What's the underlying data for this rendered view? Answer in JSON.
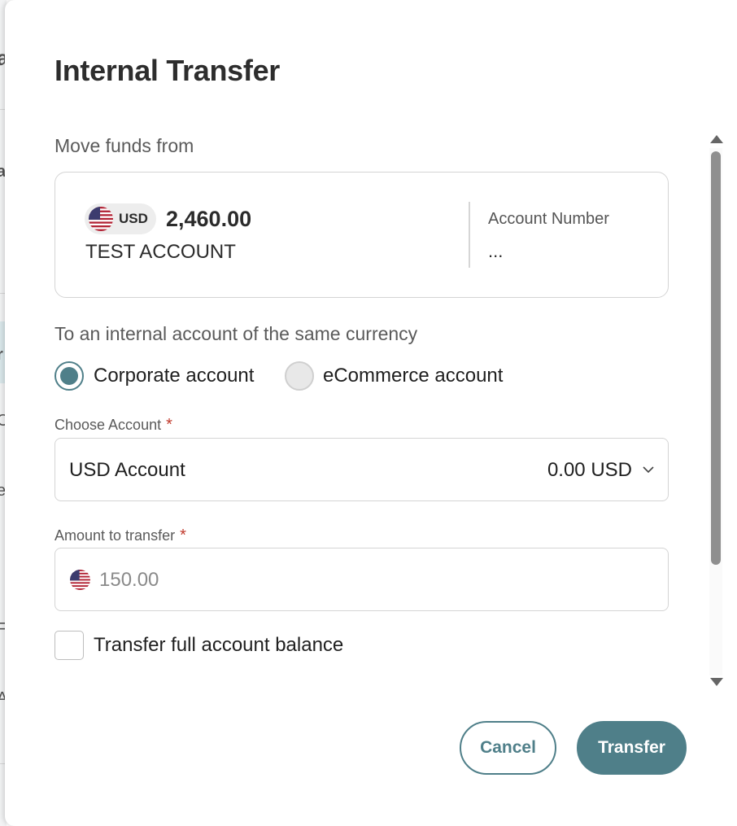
{
  "modal": {
    "title": "Internal Transfer"
  },
  "from": {
    "section_label": "Move funds from",
    "currency_code": "USD",
    "balance": "2,460.00",
    "account_name": "TEST ACCOUNT",
    "account_number_label": "Account Number",
    "account_number_value": "..."
  },
  "to": {
    "section_label": "To an internal account of the same currency",
    "options": [
      {
        "label": "Corporate account",
        "selected": true
      },
      {
        "label": "eCommerce account",
        "selected": false
      }
    ]
  },
  "choose_account": {
    "label": "Choose Account",
    "required_mark": "*",
    "selected_value": "USD Account",
    "selected_balance": "0.00 USD"
  },
  "amount": {
    "label": "Amount to transfer",
    "required_mark": "*",
    "placeholder": "150.00",
    "value": ""
  },
  "full_balance": {
    "label": "Transfer full account balance",
    "checked": false
  },
  "actions": {
    "cancel_label": "Cancel",
    "transfer_label": "Transfer"
  },
  "background": {
    "fragments": [
      "a",
      "a",
      "r",
      "C",
      "e",
      "F",
      "A"
    ]
  },
  "colors": {
    "accent": "#4f7f89",
    "required": "#c0392b",
    "border": "#d4d4d4"
  },
  "icons": {
    "flag": "us-flag-icon",
    "dropdown": "chevron-down-icon",
    "scroll_up": "scroll-up-arrow-icon",
    "scroll_down": "scroll-down-arrow-icon"
  }
}
